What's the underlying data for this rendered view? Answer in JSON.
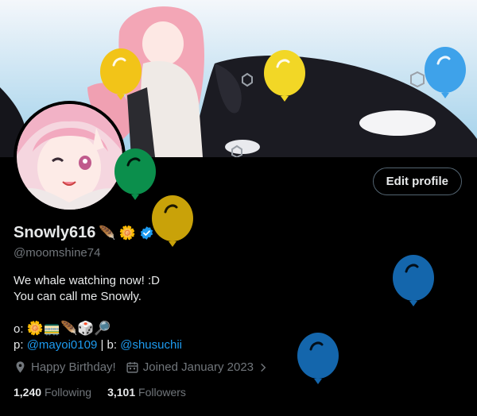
{
  "profile": {
    "display_name": "Snowly616",
    "name_emojis": [
      "🪶",
      "🌼"
    ],
    "handle": "@moomshine74",
    "edit_button_label": "Edit profile",
    "bio_line1": "We whale watching now! :D",
    "bio_line2": "You can call me Snowly.",
    "bio_line3_prefix": "o: ",
    "bio_line3_emojis": "🌼🚃🪶🎲🔎",
    "bio_line4_p_prefix": "p: ",
    "bio_line4_p_link": "@mayoi0109",
    "bio_line4_sep": " | b: ",
    "bio_line4_b_link": "@shusuchii",
    "birthday_text": "Happy Birthday!",
    "joined_text": "Joined January 2023",
    "following_count": "1,240",
    "following_label": "Following",
    "followers_count": "3,101",
    "followers_label": "Followers"
  },
  "icons": {
    "verified": "verified-badge-icon",
    "location": "location-pin-icon",
    "calendar": "calendar-icon",
    "chevron": "chevron-right-icon",
    "balloon": "balloon-icon"
  },
  "colors": {
    "accent": "#1d9bf0",
    "muted": "#71767b",
    "text": "#e7e9ea",
    "balloon_yellow": "#f2c418",
    "balloon_green": "#0b8f4c",
    "balloon_olive": "#c9a209",
    "balloon_blue": "#1466ac",
    "balloon_lightblue": "#3ea2ea"
  }
}
